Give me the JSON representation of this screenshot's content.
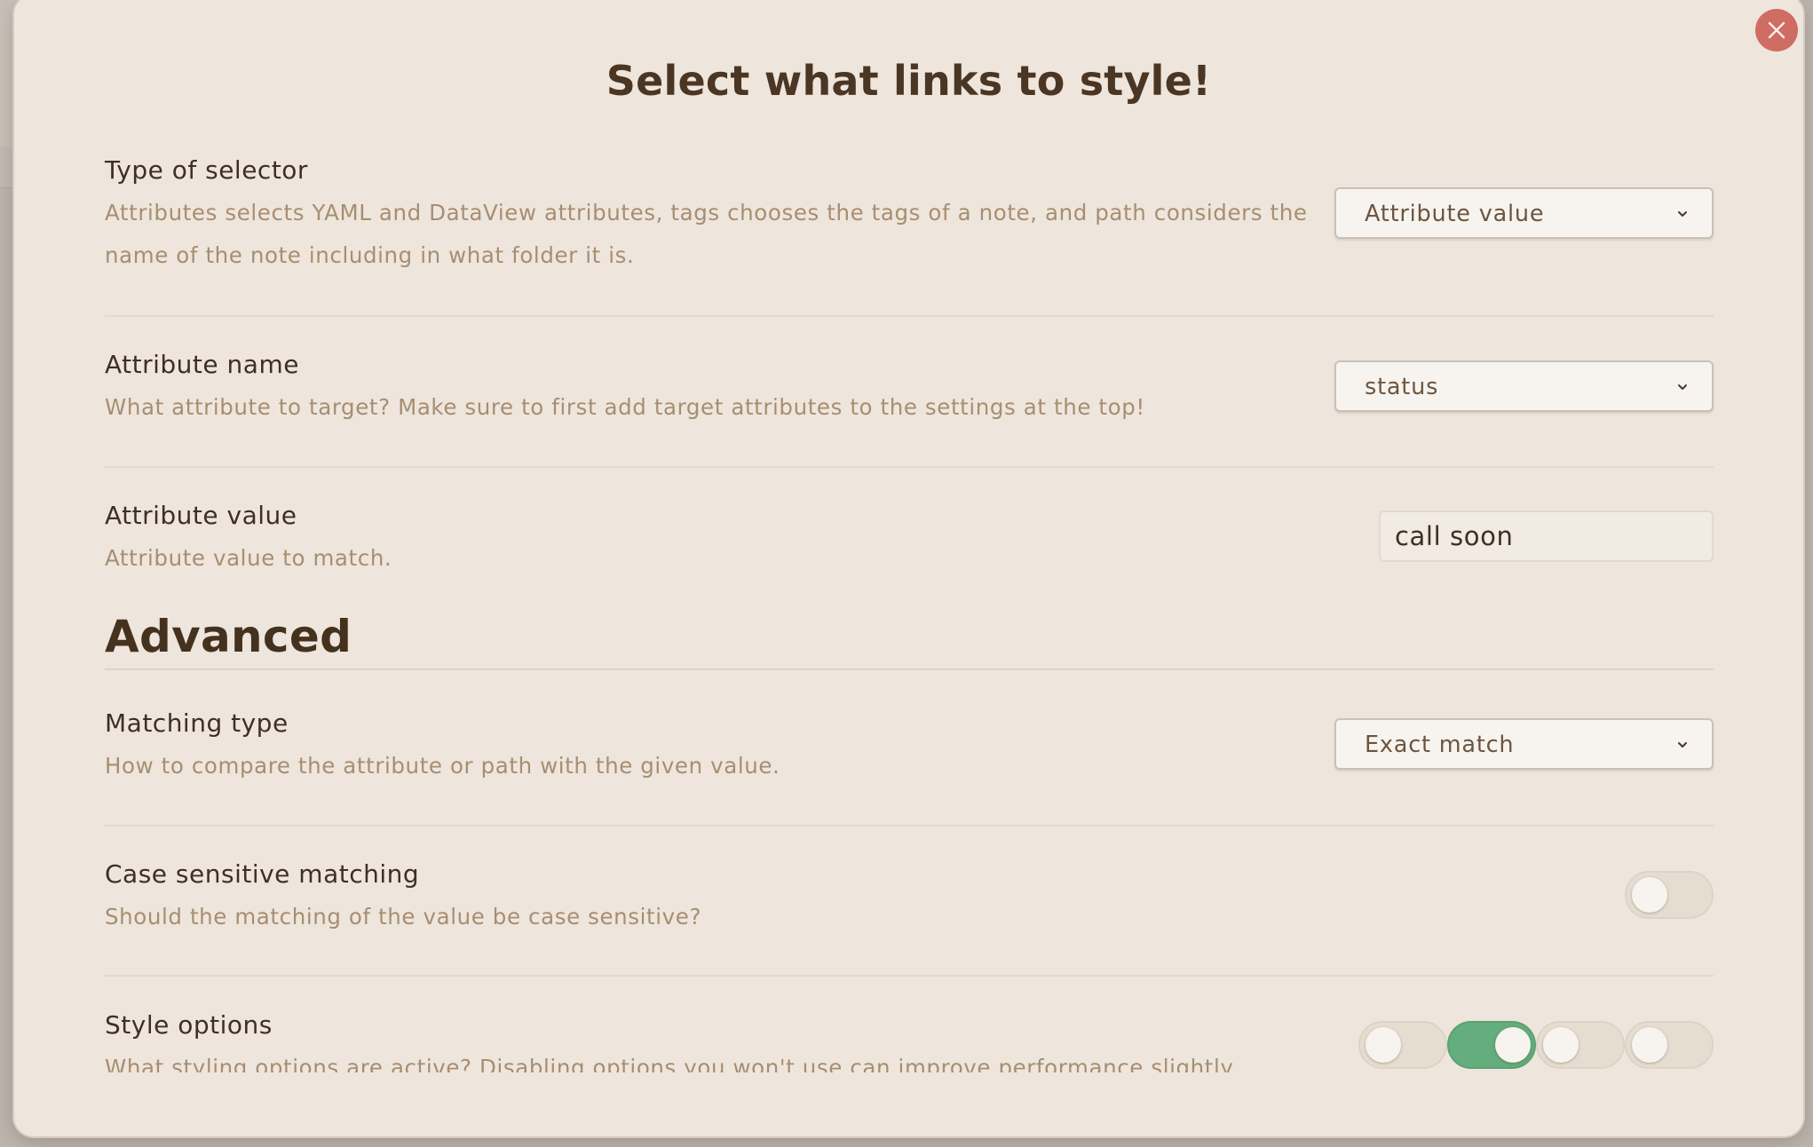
{
  "dialog": {
    "title": "Select what links to style!",
    "close_icon": "close-icon"
  },
  "settings": [
    {
      "name": "Type of selector",
      "desc": "Attributes selects YAML and DataView attributes, tags chooses the tags of a note, and path considers the name of the note including in what folder it is.",
      "control": "select",
      "value": "Attribute value"
    },
    {
      "name": "Attribute name",
      "desc": "What attribute to target? Make sure to first add target attributes to the settings at the top!",
      "control": "select",
      "value": "status"
    },
    {
      "name": "Attribute value",
      "desc": "Attribute value to match.",
      "control": "text",
      "value": "call soon"
    }
  ],
  "advanced": {
    "heading": "Advanced",
    "settings": [
      {
        "name": "Matching type",
        "desc": "How to compare the attribute or path with the given value.",
        "control": "select",
        "value": "Exact match"
      },
      {
        "name": "Case sensitive matching",
        "desc": "Should the matching of the value be case sensitive?",
        "control": "toggle",
        "on": false
      },
      {
        "name": "Style options",
        "desc": "What styling options are active? Disabling options you won't use can improve performance slightly.",
        "control": "toggles",
        "toggles": [
          false,
          true,
          false,
          false
        ]
      }
    ]
  },
  "colors": {
    "background": "#eee6dc",
    "accent_on": "#64ad7c",
    "close": "#cf6c63",
    "heading": "#4b3623",
    "muted_text": "#a78e72"
  }
}
